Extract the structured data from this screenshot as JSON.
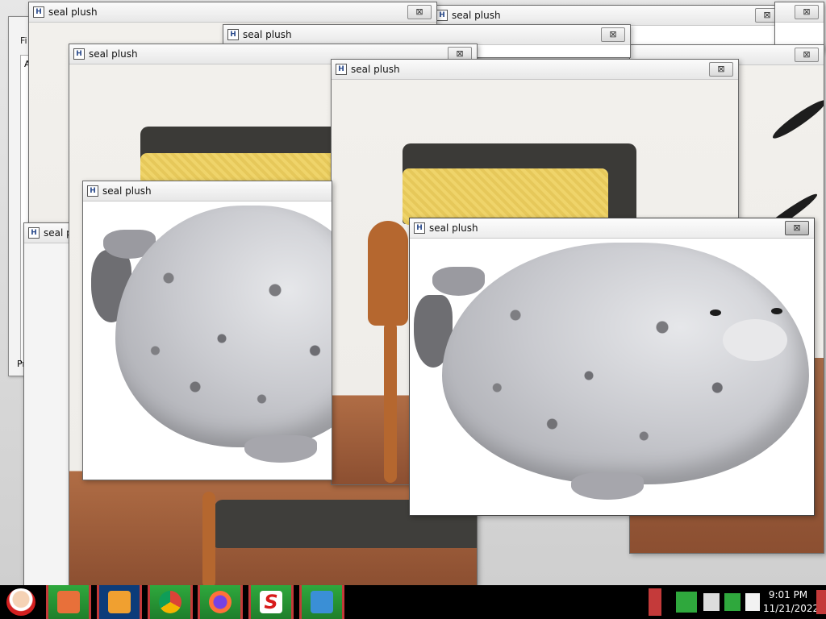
{
  "window_title": "seal plush",
  "app_icon_letter": "H",
  "close_glyph": "⊠",
  "background_app": {
    "menu_fragment": "Fi",
    "sidebar_fragment": "A",
    "status_fragment": "Pr"
  },
  "taskbar": {
    "buttons": [
      {
        "name": "file-manager-icon",
        "color": "#e8703a"
      },
      {
        "name": "media-player-icon",
        "color": "#f0a030"
      },
      {
        "name": "chrome-icon",
        "color": "#4285f4"
      },
      {
        "name": "firefox-icon",
        "color": "#ff7139"
      },
      {
        "name": "s-app-icon",
        "color": "#d81b1b"
      },
      {
        "name": "remote-desktop-icon",
        "color": "#3a8fd6"
      }
    ],
    "clock_time": "9:01 PM",
    "clock_date": "11/21/2022"
  },
  "colors": {
    "taskbar_bg": "#000000",
    "taskbar_button": "#2fa83d",
    "taskbar_border": "#c43a3a"
  }
}
